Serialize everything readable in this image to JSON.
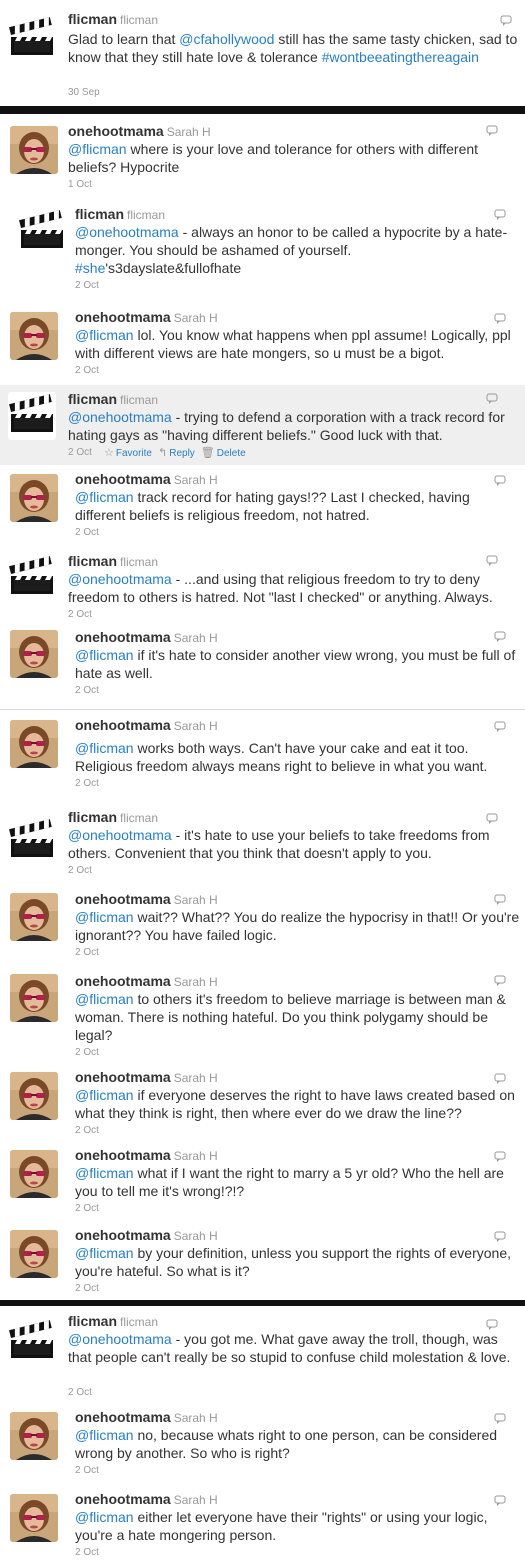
{
  "labels": {
    "favorite": "Favorite",
    "reply": "Reply",
    "delete": "Delete"
  },
  "tweets": [
    {
      "screen_name": "flicman",
      "real_name": "flicman",
      "time": "30 Sep",
      "avatar": "clapperboard",
      "parts": [
        [
          "t",
          "Glad to learn that "
        ],
        [
          "a",
          "@cfahollywood"
        ],
        [
          "t",
          " still has the same tasty chicken, sad to know that they still hate love & tolerance "
        ],
        [
          "a",
          "#wontbeeatingthereagain"
        ]
      ]
    },
    {
      "screen_name": "onehootmama",
      "real_name": "Sarah H",
      "time": "1 Oct",
      "avatar": "person",
      "parts": [
        [
          "a",
          "@flicman"
        ],
        [
          "t",
          " where is your love and tolerance for others with different beliefs? Hypocrite"
        ]
      ]
    },
    {
      "screen_name": "flicman",
      "real_name": "flicman",
      "time": "2 Oct",
      "avatar": "clapperboard",
      "parts": [
        [
          "a",
          "@onehootmama"
        ],
        [
          "t",
          " - always an honor to be called a hypocrite by a hate-monger. You should be ashamed of yourself. "
        ],
        [
          "a",
          "#she"
        ],
        [
          "t",
          "'s3dayslate&fullofhate"
        ]
      ]
    },
    {
      "screen_name": "onehootmama",
      "real_name": "Sarah H",
      "time": "2 Oct",
      "avatar": "person",
      "parts": [
        [
          "a",
          "@flicman"
        ],
        [
          "t",
          " lol. You know what happens when ppl assume! Logically, ppl with different views are hate mongers, so u must be a bigot."
        ]
      ]
    },
    {
      "screen_name": "flicman",
      "real_name": "flicman",
      "time": "2 Oct",
      "avatar": "clapperboard",
      "highlight": true,
      "parts": [
        [
          "a",
          "@onehootmama"
        ],
        [
          "t",
          " - trying to defend a corporation with a track record for hating gays as \"having different beliefs.\" Good luck with that."
        ]
      ]
    },
    {
      "screen_name": "onehootmama",
      "real_name": "Sarah H",
      "time": "2 Oct",
      "avatar": "person",
      "parts": [
        [
          "a",
          "@flicman"
        ],
        [
          "t",
          " track record for hating gays!?? Last I checked, having different beliefs is religious freedom, not hatred."
        ]
      ]
    },
    {
      "screen_name": "flicman",
      "real_name": "flicman",
      "time": "2 Oct",
      "avatar": "clapperboard",
      "parts": [
        [
          "a",
          "@onehootmama"
        ],
        [
          "t",
          " - ...and using that religious freedom to try to deny freedom to others is hatred. Not \"last I checked\" or anything. Always."
        ]
      ]
    },
    {
      "screen_name": "onehootmama",
      "real_name": "Sarah H",
      "time": "2 Oct",
      "avatar": "person",
      "parts": [
        [
          "a",
          "@flicman"
        ],
        [
          "t",
          " if it's hate to consider another view wrong, you must be full of hate as well."
        ]
      ]
    },
    {
      "screen_name": "onehootmama",
      "real_name": "Sarah H",
      "time": "2 Oct",
      "avatar": "person",
      "parts": [
        [
          "a",
          "@flicman"
        ],
        [
          "t",
          " works both ways. Can't have your cake and eat it too. Religious freedom always means right to believe in what you want."
        ]
      ]
    },
    {
      "screen_name": "flicman",
      "real_name": "flicman",
      "time": "2 Oct",
      "avatar": "clapperboard",
      "parts": [
        [
          "a",
          "@onehootmama"
        ],
        [
          "t",
          " - it's hate to use your beliefs to take freedoms from others. Convenient that you think that doesn't apply to you."
        ]
      ]
    },
    {
      "screen_name": "onehootmama",
      "real_name": "Sarah H",
      "time": "2 Oct",
      "avatar": "person",
      "parts": [
        [
          "a",
          "@flicman"
        ],
        [
          "t",
          " wait?? What?? You do realize the hypocrisy in that!! Or you're ignorant?? You have failed logic."
        ]
      ]
    },
    {
      "screen_name": "onehootmama",
      "real_name": "Sarah H",
      "time": "2 Oct",
      "avatar": "person",
      "parts": [
        [
          "a",
          "@flicman"
        ],
        [
          "t",
          " to others it's freedom to believe marriage is between man & woman. There is nothing hateful. Do you think polygamy should be legal?"
        ]
      ]
    },
    {
      "screen_name": "onehootmama",
      "real_name": "Sarah H",
      "time": "2 Oct",
      "avatar": "person",
      "parts": [
        [
          "a",
          "@flicman"
        ],
        [
          "t",
          " if everyone deserves the right to have laws created based on what they think is right, then where ever do we draw the line??"
        ]
      ]
    },
    {
      "screen_name": "onehootmama",
      "real_name": "Sarah H",
      "time": "2 Oct",
      "avatar": "person",
      "parts": [
        [
          "a",
          "@flicman"
        ],
        [
          "t",
          " what if I want the right to marry a 5 yr old? Who the hell are you to tell me it's wrong!?!?"
        ]
      ]
    },
    {
      "screen_name": "onehootmama",
      "real_name": "Sarah H",
      "time": "2 Oct",
      "avatar": "person",
      "parts": [
        [
          "a",
          "@flicman"
        ],
        [
          "t",
          " by your definition, unless you support the rights of everyone, you're hateful. So what is it?"
        ]
      ]
    },
    {
      "screen_name": "flicman",
      "real_name": "flicman",
      "time": "2 Oct",
      "avatar": "clapperboard",
      "parts": [
        [
          "a",
          "@onehootmama"
        ],
        [
          "t",
          " - you got me. What gave away the troll, though, was that people can't really be so stupid to confuse child molestation & love."
        ]
      ]
    },
    {
      "screen_name": "onehootmama",
      "real_name": "Sarah H",
      "time": "2 Oct",
      "avatar": "person",
      "parts": [
        [
          "a",
          "@flicman"
        ],
        [
          "t",
          " no, because whats right to one person, can be considered wrong by another. So who is right?"
        ]
      ]
    },
    {
      "screen_name": "onehootmama",
      "real_name": "Sarah H",
      "time": "2 Oct",
      "avatar": "person",
      "parts": [
        [
          "a",
          "@flicman"
        ],
        [
          "t",
          " either let everyone have their \"rights\" or using your logic, you're a hate mongering person."
        ]
      ]
    }
  ]
}
